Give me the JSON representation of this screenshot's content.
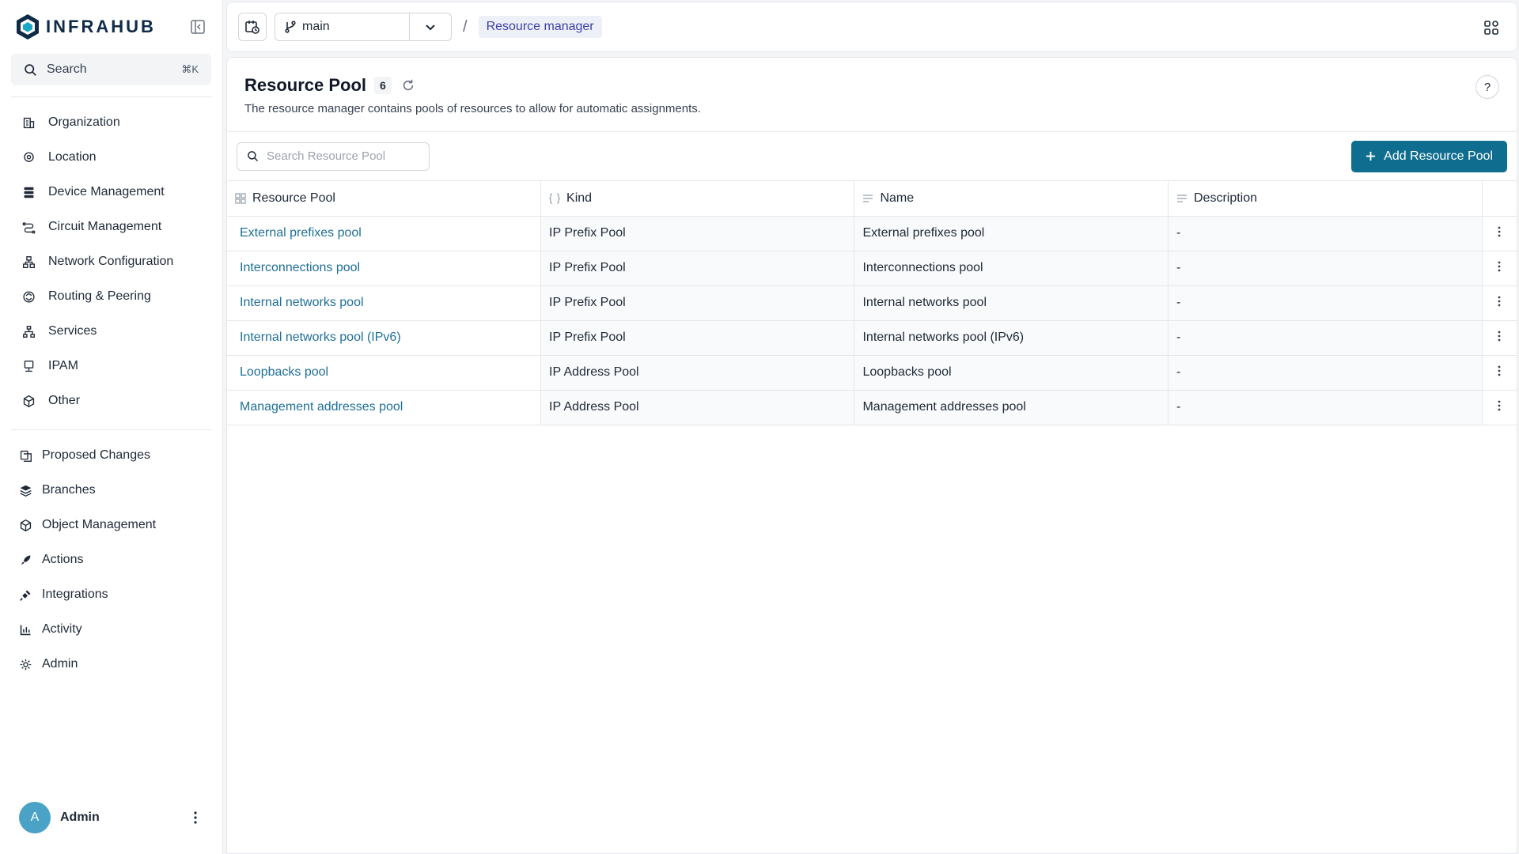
{
  "brand": {
    "name": "INFRAHUB"
  },
  "search": {
    "label": "Search",
    "shortcut": "⌘K"
  },
  "nav_primary": [
    {
      "label": "Organization",
      "icon": "building-icon"
    },
    {
      "label": "Location",
      "icon": "location-pin-icon"
    },
    {
      "label": "Device Management",
      "icon": "server-icon"
    },
    {
      "label": "Circuit Management",
      "icon": "circuit-icon"
    },
    {
      "label": "Network Configuration",
      "icon": "network-icon"
    },
    {
      "label": "Routing & Peering",
      "icon": "routing-icon"
    },
    {
      "label": "Services",
      "icon": "services-icon"
    },
    {
      "label": "IPAM",
      "icon": "ipam-icon"
    },
    {
      "label": "Other",
      "icon": "cube-icon"
    }
  ],
  "nav_secondary": [
    {
      "label": "Proposed Changes",
      "icon": "proposed-changes-icon"
    },
    {
      "label": "Branches",
      "icon": "layers-icon"
    },
    {
      "label": "Object Management",
      "icon": "box-icon"
    },
    {
      "label": "Actions",
      "icon": "rocket-icon"
    },
    {
      "label": "Integrations",
      "icon": "plug-icon"
    },
    {
      "label": "Activity",
      "icon": "chart-icon"
    },
    {
      "label": "Admin",
      "icon": "gear-icon"
    }
  ],
  "user": {
    "initial": "A",
    "name": "Admin"
  },
  "topbar": {
    "branch": "main",
    "breadcrumb": "Resource manager"
  },
  "page": {
    "title": "Resource Pool",
    "count": "6",
    "subtitle": "The resource manager contains pools of resources to allow for automatic assignments.",
    "help": "?"
  },
  "toolbar": {
    "search_placeholder": "Search Resource Pool",
    "add_label": "Add Resource Pool"
  },
  "table": {
    "headers": [
      "Resource Pool",
      "Kind",
      "Name",
      "Description"
    ],
    "rows": [
      [
        "External prefixes pool",
        "IP Prefix Pool",
        "External prefixes pool",
        "-"
      ],
      [
        "Interconnections pool",
        "IP Prefix Pool",
        "Interconnections pool",
        "-"
      ],
      [
        "Internal networks pool",
        "IP Prefix Pool",
        "Internal networks pool",
        "-"
      ],
      [
        "Internal networks pool (IPv6)",
        "IP Prefix Pool",
        "Internal networks pool (IPv6)",
        "-"
      ],
      [
        "Loopbacks pool",
        "IP Address Pool",
        "Loopbacks pool",
        "-"
      ],
      [
        "Management addresses pool",
        "IP Address Pool",
        "Management addresses pool",
        "-"
      ]
    ]
  },
  "colors": {
    "accent": "#0f6e8f",
    "link": "#1f6f97",
    "avatar": "#4aa3c7"
  }
}
